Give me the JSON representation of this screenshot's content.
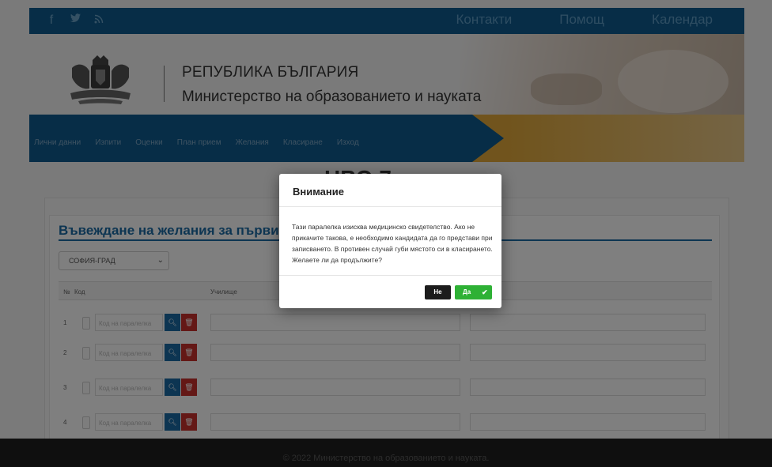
{
  "social": [
    "f",
    "twitter",
    "rss"
  ],
  "toplinks": [
    "Контакти",
    "Помощ",
    "Календар"
  ],
  "header": {
    "org_line1": "РЕПУБЛИКА БЪЛГАРИЯ",
    "org_line2": "Министерство на образованието и науката"
  },
  "nav": [
    "Лични данни",
    "Изпити",
    "Оценки",
    "План прием",
    "Желания",
    "Класиране",
    "Изход"
  ],
  "page_title": "НВО 7 клас",
  "section": {
    "title": "Въвеждане на желания за първи",
    "select_value": "СОФИЯ-ГРАД"
  },
  "table": {
    "headers": [
      "№",
      "Код",
      "Училище"
    ],
    "rows": [
      {
        "num": "1",
        "placeholder": "Код на паралелка"
      },
      {
        "num": "2",
        "placeholder": "Код на паралелка"
      },
      {
        "num": "3",
        "placeholder": "Код на паралелка"
      },
      {
        "num": "4",
        "placeholder": "Код на паралелка"
      }
    ]
  },
  "modal": {
    "title": "Внимание",
    "body": "Тази паралелка изисква медицинско свидетелство. Ако не прикачите такова, е необходимо кандидата да го представи при записването. В противен случай губи мястото си в класирането. Желаете ли да продължите?",
    "no_label": "Не",
    "yes_label": "Да"
  },
  "footer": {
    "text": "© 2022 Министерство на образованието и науката."
  },
  "colors": {
    "brand_blue": "#0f5b8f",
    "accent_gold": "#e2a93a",
    "yes_green": "#2eb135",
    "no_black": "#1c1c1c",
    "delete_red": "#c9302c"
  },
  "icons": {
    "search": "search-icon",
    "delete": "trash-icon",
    "check": "check-icon"
  }
}
